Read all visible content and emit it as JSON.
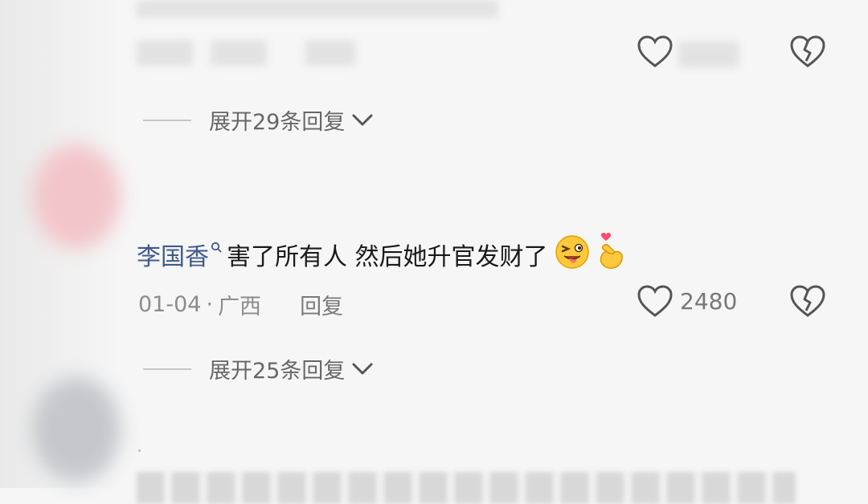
{
  "thread": {
    "comment_top": {
      "expand_label": "展开29条回复"
    },
    "comment_main": {
      "author": "李国香",
      "text": "害了所有人 然后她升官发财了",
      "date": "01-04",
      "separator": "·",
      "location": "广西",
      "reply_label": "回复",
      "like_count": "2480",
      "expand_label": "展开25条回复",
      "emojis": [
        "winking-tongue-face-emoji",
        "finger-heart-emoji"
      ]
    }
  },
  "colors": {
    "author": "#405a8c",
    "text": "#1a1a1a",
    "meta": "#8c8c8c",
    "background": "#f6f6f6"
  }
}
